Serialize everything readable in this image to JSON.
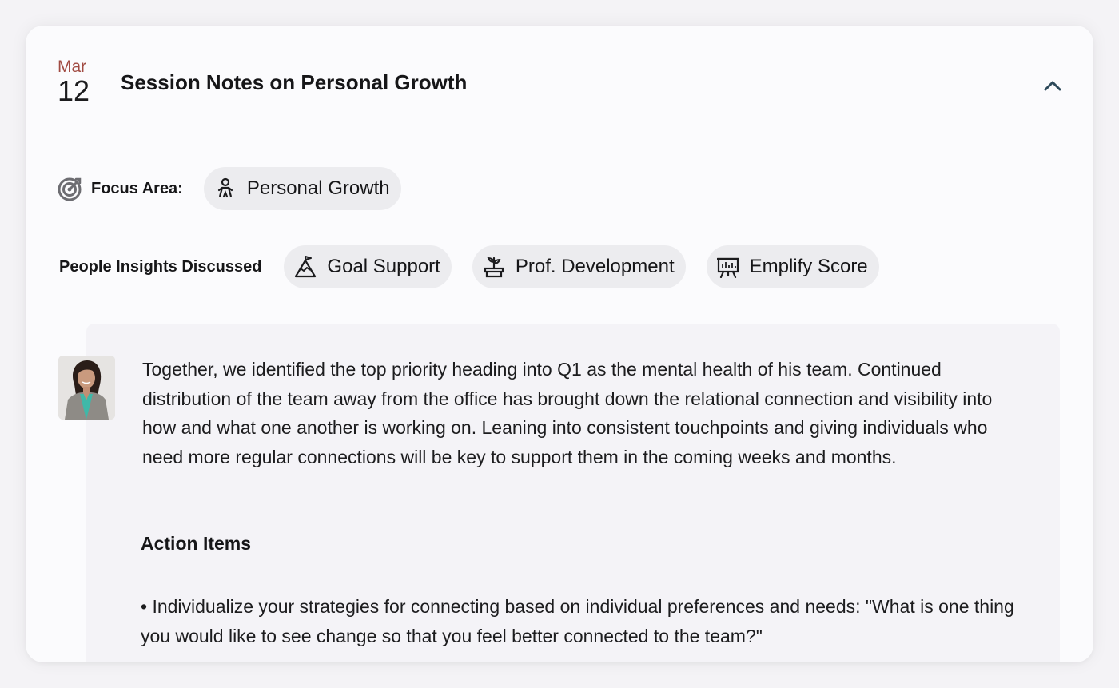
{
  "session": {
    "date_month": "Mar",
    "date_day": "12",
    "title": "Session Notes on Personal Growth",
    "collapse_icon": "chevron-up-icon"
  },
  "focus": {
    "label": "Focus Area:",
    "label_icon": "target-icon",
    "chip": {
      "label": "Personal Growth",
      "icon": "person-growth-icon"
    }
  },
  "insights": {
    "label": "People Insights Discussed",
    "chips": [
      {
        "label": "Goal Support",
        "icon": "summit-flag-icon"
      },
      {
        "label": "Prof. Development",
        "icon": "seedling-pot-icon"
      },
      {
        "label": "Emplify Score",
        "icon": "presentation-board-icon"
      }
    ]
  },
  "note": {
    "avatar": "author-avatar",
    "body": "Together, we identified the top priority heading into Q1 as the mental health of his team. Continued distribution of the team away from the office has brought down the relational connection and visibility into how and what one another is working on. Leaning into consistent touchpoints and giving individuals who need more regular connections will be key to support them in the coming weeks and months.",
    "action_title": "Action Items",
    "action_items": [
      "• Individualize your strategies for connecting based on individual preferences and needs: \"What is one thing you would like to see change so that you feel better connected to the team?\""
    ]
  },
  "colors": {
    "month": "#a14b43",
    "chip_bg": "#ececef",
    "panel_bg": "#f4f3f7",
    "chevron": "#2d4a5a"
  }
}
